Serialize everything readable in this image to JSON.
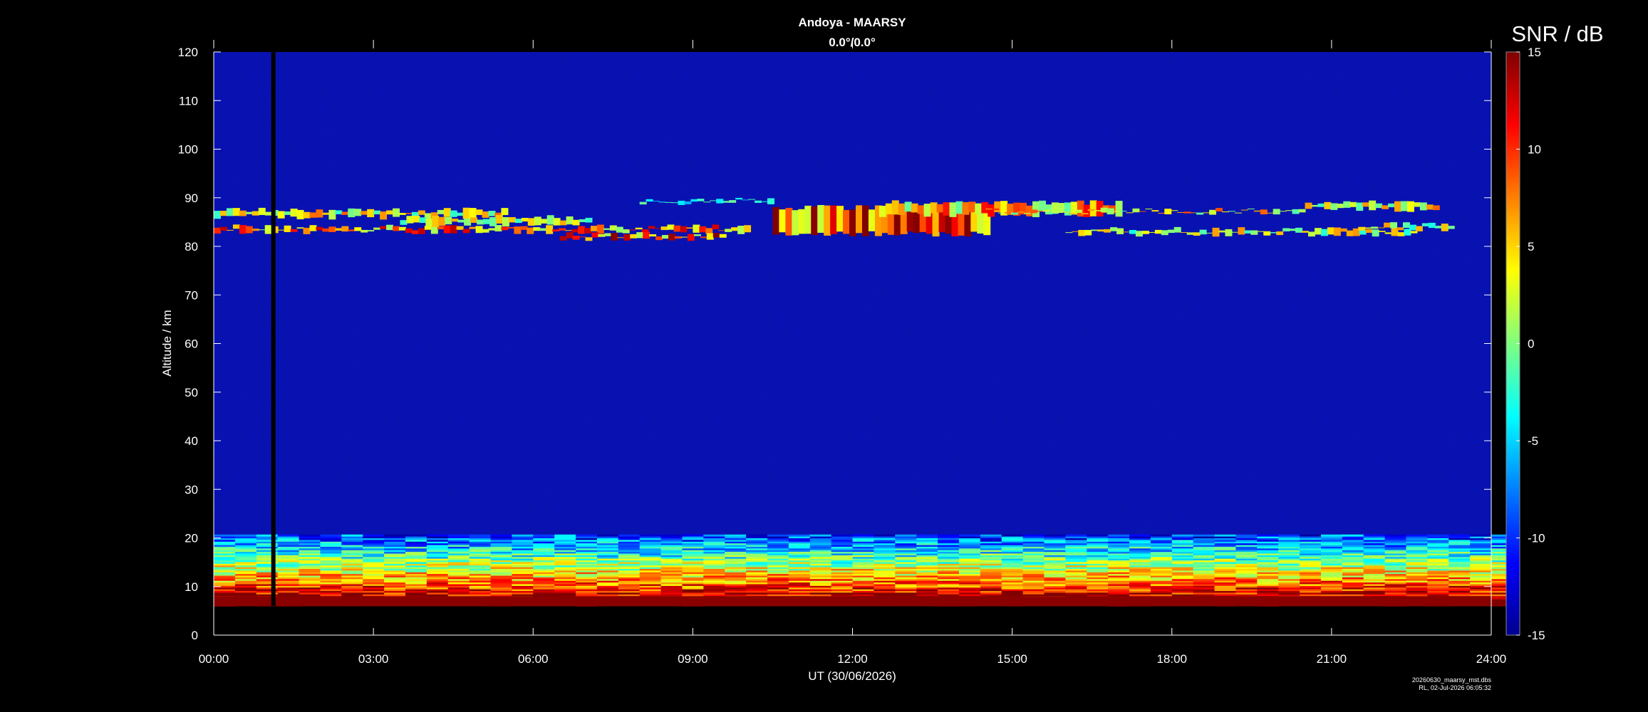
{
  "chart_data": {
    "type": "heatmap",
    "title": "Andoya - MAARSY",
    "subtitle": "0.0°/0.0°",
    "xlabel": "UT (30/06/2026)",
    "ylabel": "Altitude / km",
    "x_ticks": [
      "00:00",
      "03:00",
      "06:00",
      "09:00",
      "12:00",
      "15:00",
      "18:00",
      "21:00",
      "24:00"
    ],
    "xlim_hours": [
      0,
      24
    ],
    "y_ticks": [
      0,
      10,
      20,
      30,
      40,
      50,
      60,
      70,
      80,
      90,
      100,
      110,
      120
    ],
    "ylim": [
      0,
      120
    ],
    "colorbar": {
      "label": "SNR / dB",
      "ticks": [
        -15,
        -10,
        -5,
        0,
        5,
        10,
        15
      ],
      "range": [
        -15,
        15
      ],
      "colormap": "jet"
    },
    "grid": false,
    "data_gap_hours": [
      1.08,
      1.16
    ],
    "footer_lines": [
      "20260630_maarsy_mst.dbs",
      "RL, 02-Jul-2026 06:05:32"
    ],
    "features": {
      "mesospheric_echo_layer_km": [
        80,
        90
      ],
      "lower_atmosphere_echoes_km": [
        6,
        20
      ],
      "background_snr_db": -13
    }
  }
}
